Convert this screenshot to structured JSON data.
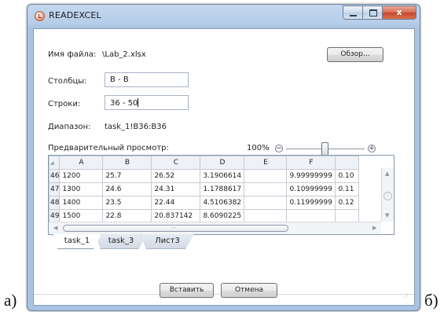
{
  "outer_labels": {
    "left": "а)",
    "right": "б)"
  },
  "window": {
    "title": "READEXCEL",
    "close_glyph": "x"
  },
  "form": {
    "file_label": "Имя файла:",
    "file_value": "\\Lab_2.xlsx",
    "browse_label": "Обзор...",
    "columns_label": "Столбцы:",
    "columns_value": "B - B",
    "rows_label": "Строки:",
    "rows_value": "36 - 50",
    "range_label": "Диапазон:",
    "range_value": "task_1!B36:B36",
    "preview_label": "Предварительный просмотр:",
    "zoom_value": "100%",
    "zoom_minus": "−",
    "zoom_plus": "+"
  },
  "grid": {
    "columns": [
      "A",
      "B",
      "C",
      "D",
      "E",
      "F",
      ""
    ],
    "rows": [
      {
        "num": "46",
        "cells": [
          "1200",
          "25.7",
          "26.52",
          "3.1906614",
          "",
          "9.99999999",
          "0.10"
        ]
      },
      {
        "num": "47",
        "cells": [
          "1300",
          "24.6",
          "24.31",
          "1.1788617",
          "",
          "0.10999999",
          "0.11"
        ]
      },
      {
        "num": "48",
        "cells": [
          "1400",
          "23.5",
          "22.44",
          "4.5106382",
          "",
          "0.11999999",
          "0.12"
        ]
      },
      {
        "num": "49",
        "cells": [
          "1500",
          "22.8",
          "20.837142",
          "8.6090225",
          "",
          "",
          ""
        ]
      }
    ],
    "scroll_dots": "...",
    "arrow_up": "▲",
    "arrow_down": "▼",
    "arrow_left": "◀",
    "arrow_right": "▶"
  },
  "sheets": [
    "task_1",
    "task_3",
    "Лист3"
  ],
  "active_sheet": "task_1",
  "footer": {
    "insert_label": "Вставить",
    "cancel_label": "Отмена"
  },
  "colors": {
    "window_frame": "#a9c3e3",
    "close_button": "#c4462a"
  }
}
